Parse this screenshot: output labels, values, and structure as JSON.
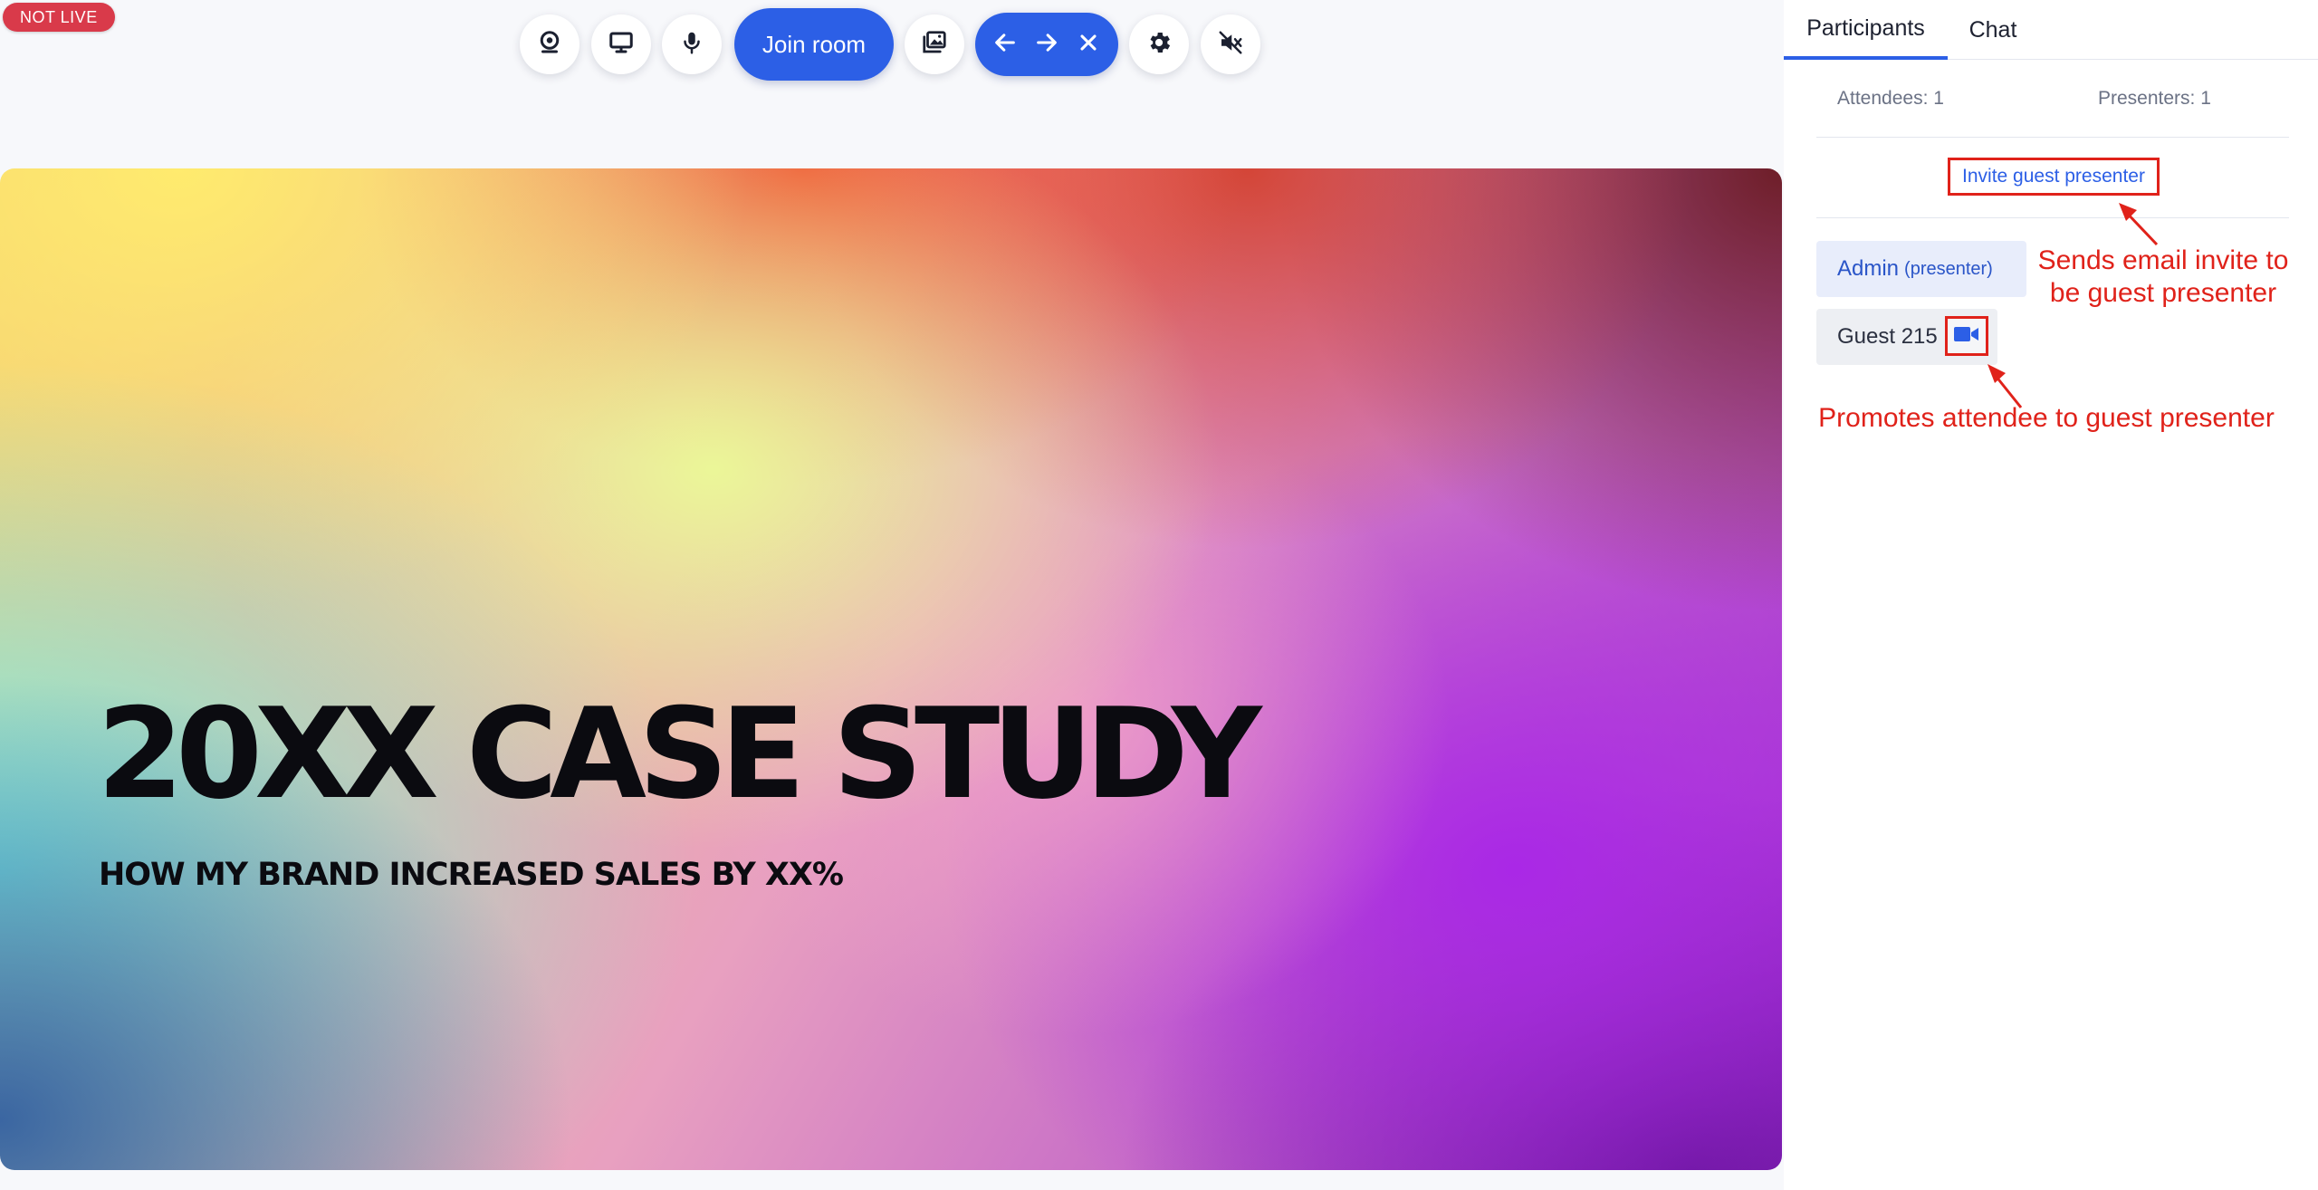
{
  "status_badge": "NOT LIVE",
  "toolbar": {
    "join_label": "Join room",
    "buttons": [
      "webcam-icon",
      "screen-share-icon",
      "microphone-icon",
      "media-library-icon",
      "settings-icon",
      "speaker-muted-icon"
    ],
    "nav": [
      "arrow-left-icon",
      "arrow-right-icon",
      "close-icon"
    ]
  },
  "slide": {
    "title": "20XX CASE STUDY",
    "subtitle": "HOW MY BRAND INCREASED SALES BY XX%"
  },
  "panel": {
    "tabs": [
      "Participants",
      "Chat"
    ],
    "attendees": "Attendees: 1",
    "presenters": "Presenters: 1",
    "invite_label": "Invite guest presenter",
    "participants": [
      {
        "name": "Admin",
        "role": "(presenter)"
      },
      {
        "name": "Guest 215"
      }
    ]
  },
  "annotations": {
    "invite_line1": "Sends email invite to",
    "invite_line2": "be guest presenter",
    "promote": "Promotes attendee to guest presenter"
  },
  "colors": {
    "accent": "#2c5fe6",
    "annotation": "#e0221a",
    "badge": "#d93a4a"
  }
}
